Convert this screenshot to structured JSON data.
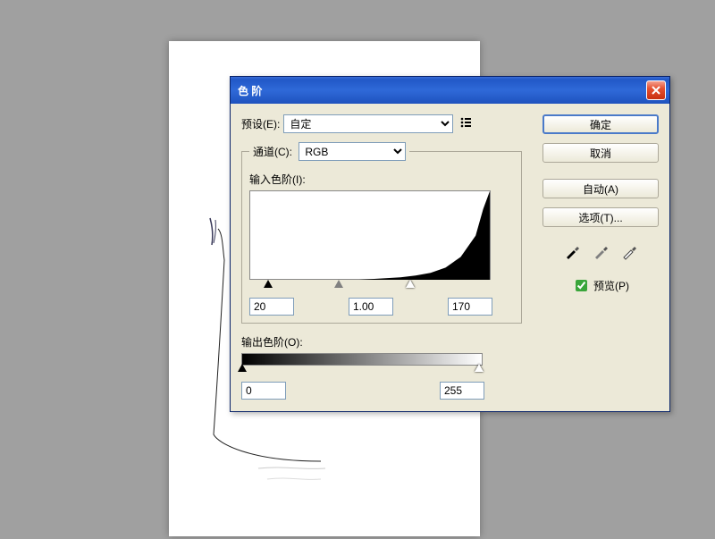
{
  "dialog_title": "色 阶",
  "preset": {
    "label": "预设(E):",
    "value": "自定"
  },
  "channel": {
    "label": "通道(C):",
    "value": "RGB"
  },
  "input_levels": {
    "label": "输入色阶(I):",
    "shadow": "20",
    "mid": "1.00",
    "highlight": "170"
  },
  "output_levels": {
    "label": "输出色阶(O):",
    "low": "0",
    "high": "255"
  },
  "buttons": {
    "ok": "确定",
    "cancel": "取消",
    "auto": "自动(A)",
    "options": "选项(T)..."
  },
  "preview_label": "预览(P)",
  "chart_data": {
    "type": "area",
    "title": "",
    "xlabel": "",
    "ylabel": "",
    "x": [
      0,
      16,
      32,
      48,
      64,
      80,
      96,
      112,
      128,
      144,
      160,
      176,
      192,
      208,
      224,
      240,
      248,
      255
    ],
    "values": [
      0,
      0,
      0,
      0,
      0,
      0,
      0,
      0,
      1,
      2,
      3,
      5,
      8,
      14,
      26,
      50,
      80,
      100
    ],
    "xlim": [
      0,
      255
    ],
    "ylim": [
      0,
      100
    ]
  }
}
